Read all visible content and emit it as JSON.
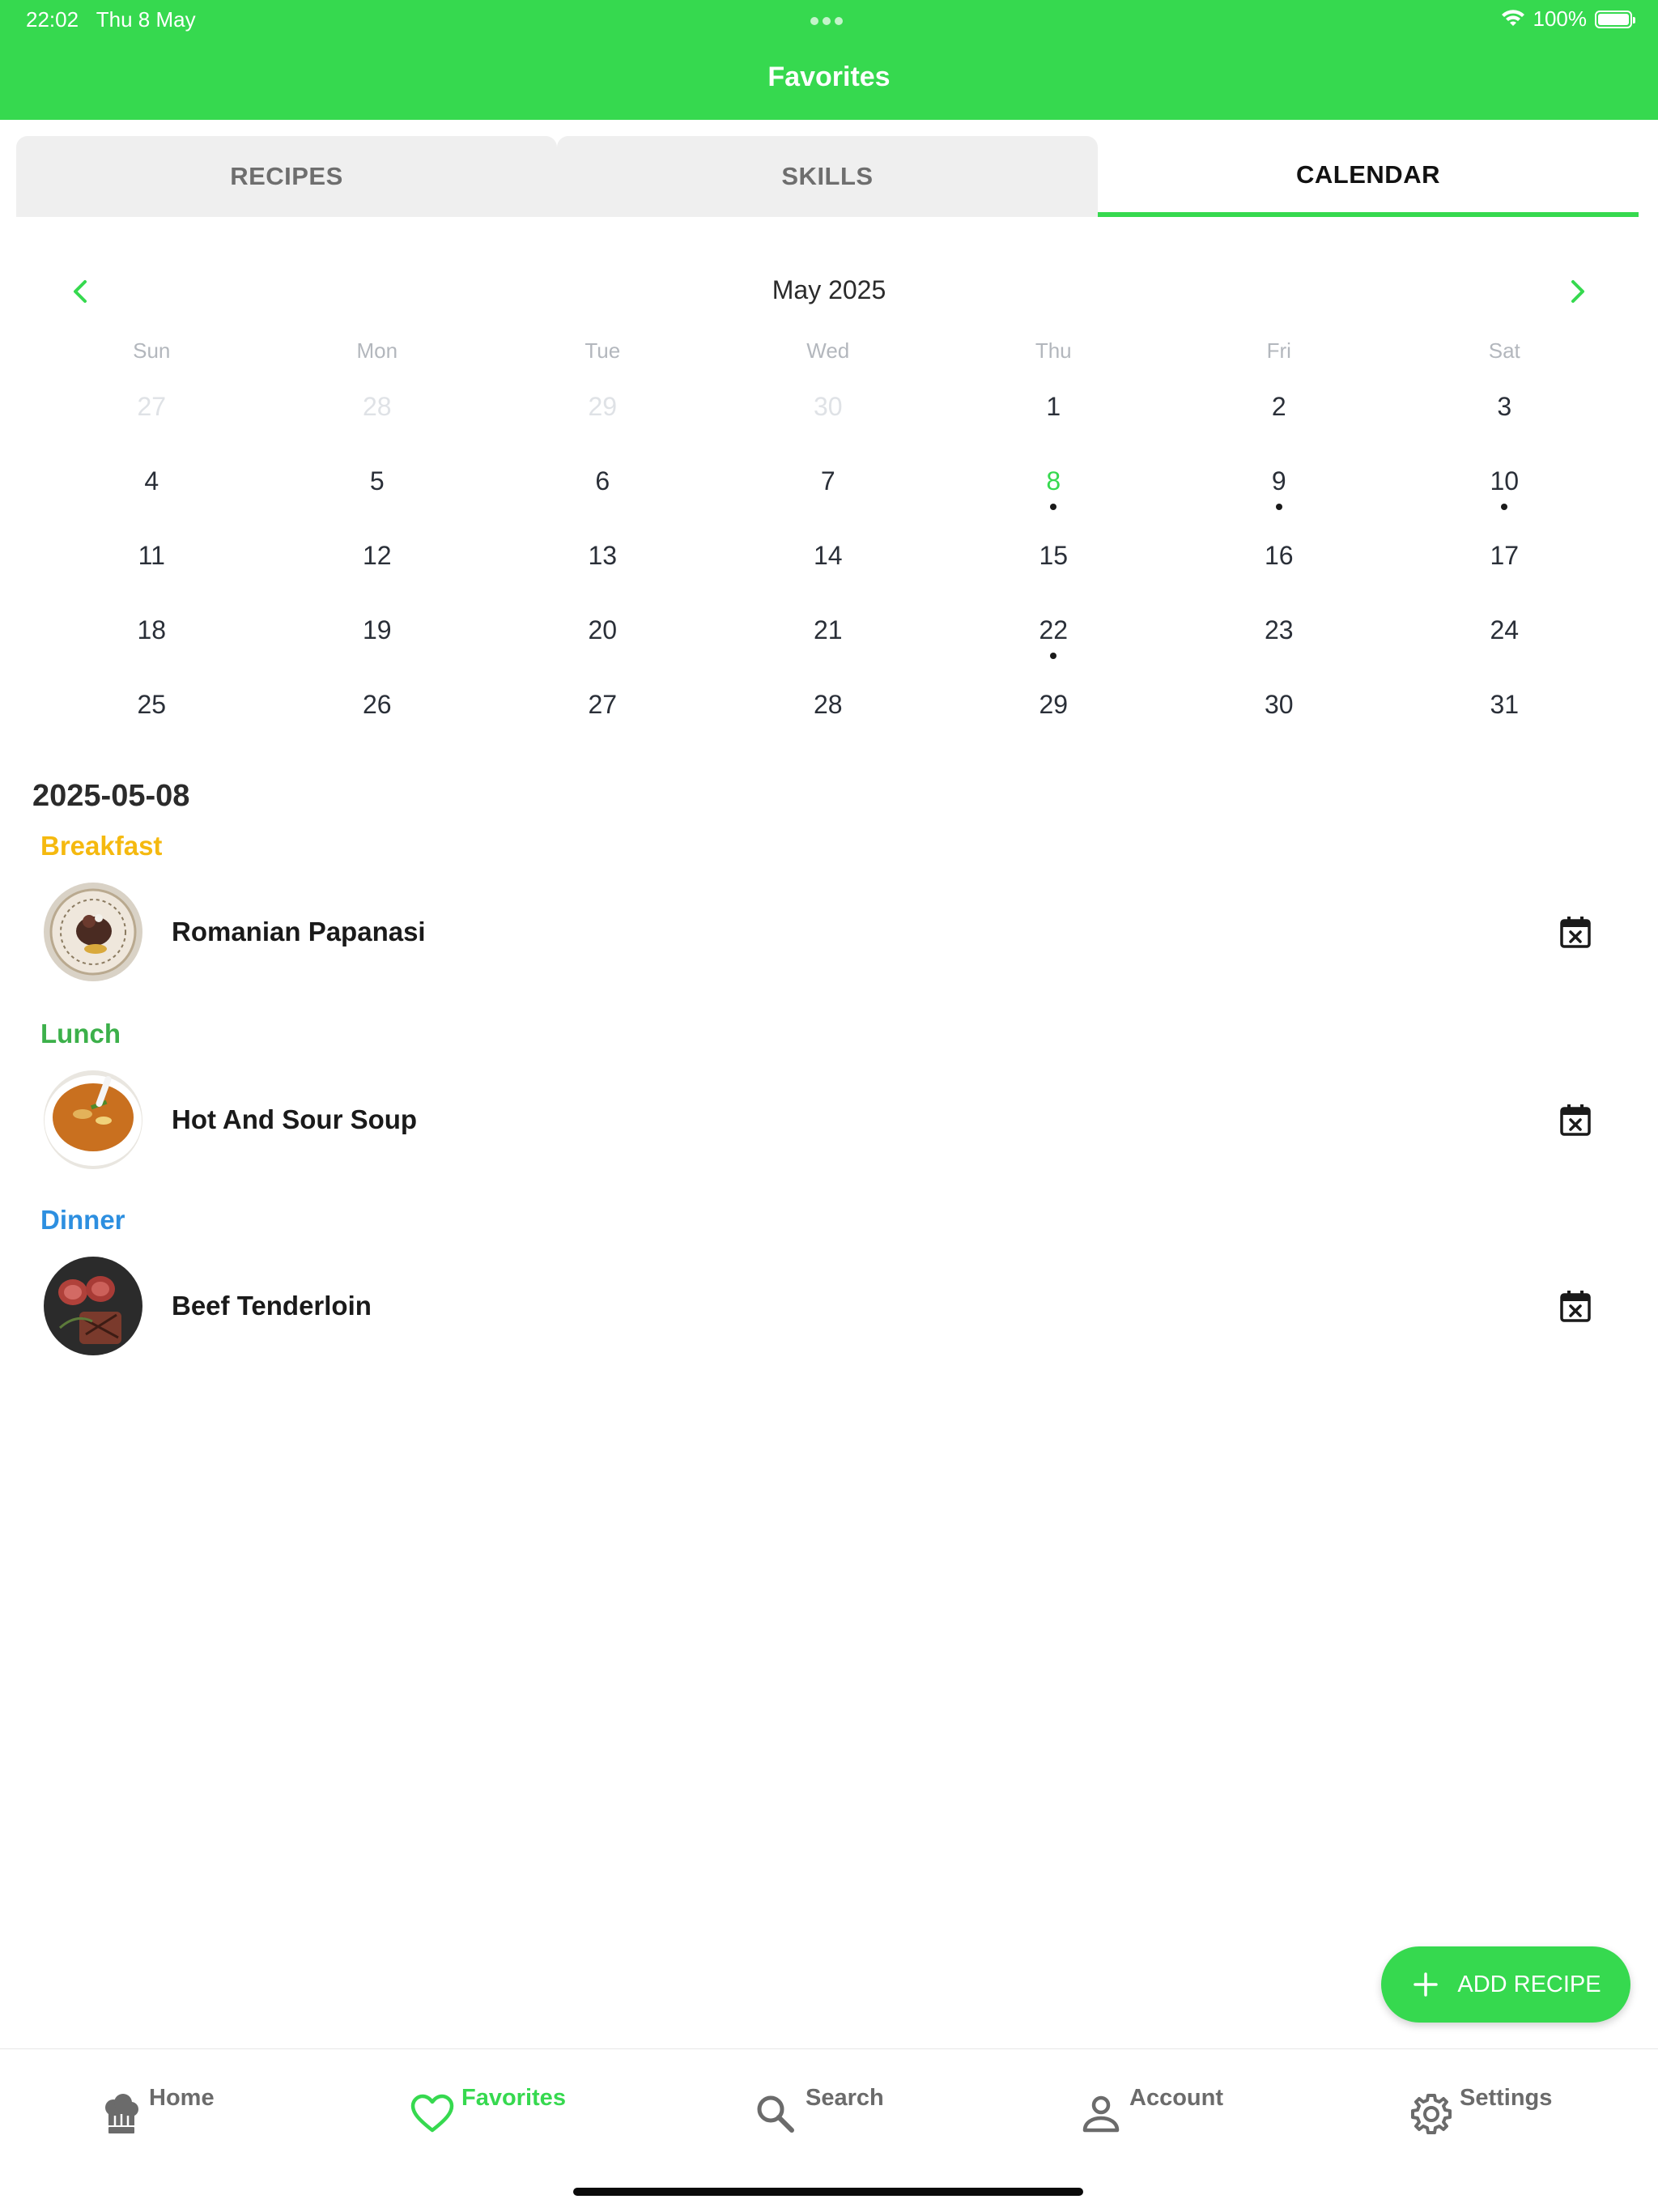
{
  "status_bar": {
    "time": "22:02",
    "date": "Thu 8 May",
    "battery": "100%"
  },
  "header": {
    "title": "Favorites"
  },
  "tabs": [
    {
      "label": "RECIPES",
      "active": false
    },
    {
      "label": "SKILLS",
      "active": false
    },
    {
      "label": "CALENDAR",
      "active": true
    }
  ],
  "calendar": {
    "month_label": "May 2025",
    "weekdays": [
      "Sun",
      "Mon",
      "Tue",
      "Wed",
      "Thu",
      "Fri",
      "Sat"
    ],
    "weeks": [
      [
        "27",
        "28",
        "29",
        "30",
        "1",
        "2",
        "3"
      ],
      [
        "4",
        "5",
        "6",
        "7",
        "8",
        "9",
        "10"
      ],
      [
        "11",
        "12",
        "13",
        "14",
        "15",
        "16",
        "17"
      ],
      [
        "18",
        "19",
        "20",
        "21",
        "22",
        "23",
        "24"
      ],
      [
        "25",
        "26",
        "27",
        "28",
        "29",
        "30",
        "31"
      ]
    ],
    "today": "8",
    "event_days": [
      "8",
      "9",
      "10",
      "22"
    ]
  },
  "schedule": {
    "selected_date": "2025-05-08",
    "meals": [
      {
        "type": "Breakfast",
        "color": "#f5b90f",
        "recipe": "Romanian Papanasi"
      },
      {
        "type": "Lunch",
        "color": "#3cb04a",
        "recipe": "Hot And Sour Soup"
      },
      {
        "type": "Dinner",
        "color": "#2d8fe0",
        "recipe": "Beef Tenderloin"
      }
    ]
  },
  "fab": {
    "label": "ADD RECIPE"
  },
  "bottom_nav": [
    {
      "label": "Home",
      "icon": "chef-hat-icon",
      "active": false
    },
    {
      "label": "Favorites",
      "icon": "heart-icon",
      "active": true
    },
    {
      "label": "Search",
      "icon": "search-icon",
      "active": false
    },
    {
      "label": "Account",
      "icon": "person-icon",
      "active": false
    },
    {
      "label": "Settings",
      "icon": "gear-icon",
      "active": false
    }
  ],
  "colors": {
    "accent": "#36d94f"
  }
}
